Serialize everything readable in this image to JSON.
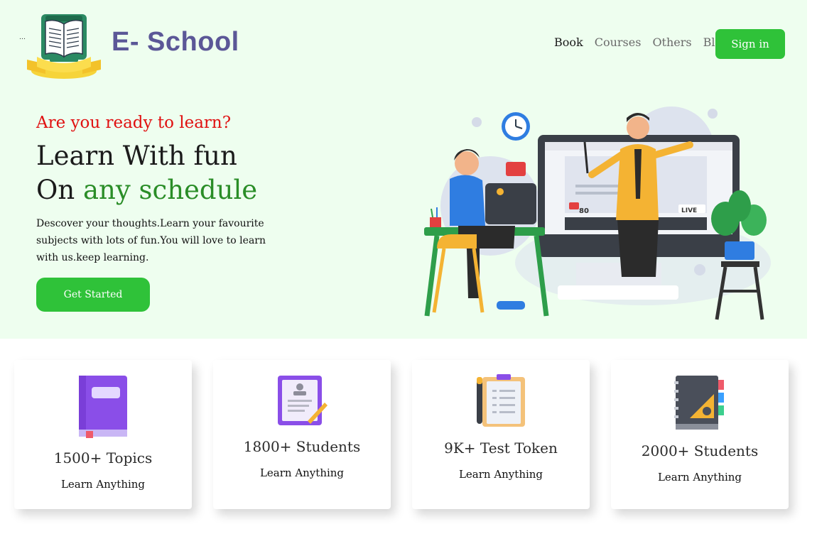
{
  "header": {
    "ellipsis": "…",
    "brand": "E- School",
    "nav": [
      "Book",
      "Courses",
      "Others",
      "Blog"
    ],
    "signin_label": "Sign in"
  },
  "hero": {
    "kicker": "Are you ready to learn?",
    "headline_line1": "Learn With fun",
    "headline_on": "On ",
    "headline_green": "any schedule",
    "description": "Descover your thoughts.Learn your favourite subjects with lots of fun.You will love to learn with us.keep learning.",
    "cta_label": "Get Started",
    "screen_views": "80",
    "screen_live": "LIVE"
  },
  "stats": [
    {
      "value": "1500+ Topics",
      "label": "Learn Anything",
      "icon": "purple-book-icon"
    },
    {
      "value": "1800+ Students",
      "label": "Learn Anything",
      "icon": "certificate-pen-icon"
    },
    {
      "value": "9K+ Test Token",
      "label": "Learn Anything",
      "icon": "clipboard-pen-icon"
    },
    {
      "value": "2000+ Students",
      "label": "Learn Anything",
      "icon": "notebook-ruler-icon"
    }
  ],
  "colors": {
    "hero_bg": "#eefeef",
    "accent_green": "#2fc239",
    "brand": "#5b5797",
    "kicker_red": "#e01010",
    "schedule_green": "#2a8d27"
  }
}
